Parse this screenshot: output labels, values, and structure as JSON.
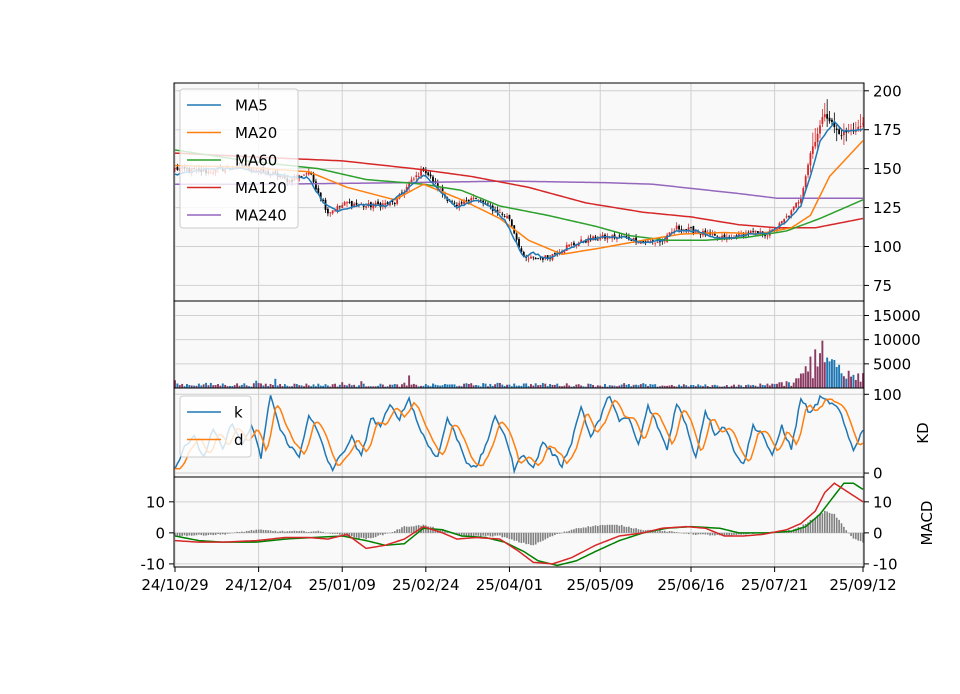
{
  "chart_data": {
    "type": "stock-candlestick",
    "x_tick_labels": [
      "24/10/29",
      "24/12/04",
      "25/01/09",
      "25/02/24",
      "25/04/01",
      "25/05/09",
      "25/06/16",
      "25/07/21",
      "25/09/12"
    ],
    "price_panel": {
      "ylim": [
        65,
        205
      ],
      "y_ticks": [
        75,
        100,
        125,
        150,
        175,
        200
      ],
      "legend": [
        "MA5",
        "MA20",
        "MA60",
        "MA120",
        "MA240"
      ],
      "legend_position": "upper-left",
      "series_colors": {
        "MA5": "#1f77b4",
        "MA20": "#ff7f0e",
        "MA60": "#2ca02c",
        "MA120": "#d62728",
        "MA240": "#9467bd"
      },
      "candle_up_color": "#d62728",
      "candle_down_color": "#000000",
      "close_anchors": [
        [
          0,
          150
        ],
        [
          14,
          148
        ],
        [
          28,
          152
        ],
        [
          42,
          146
        ],
        [
          48,
          142
        ],
        [
          56,
          148
        ],
        [
          64,
          122
        ],
        [
          72,
          128
        ],
        [
          80,
          126
        ],
        [
          92,
          128
        ],
        [
          98,
          140
        ],
        [
          104,
          150
        ],
        [
          112,
          134
        ],
        [
          118,
          125
        ],
        [
          124,
          132
        ],
        [
          132,
          125
        ],
        [
          140,
          118
        ],
        [
          146,
          92
        ],
        [
          156,
          93
        ],
        [
          164,
          100
        ],
        [
          172,
          104
        ],
        [
          180,
          106
        ],
        [
          188,
          106
        ],
        [
          196,
          103
        ],
        [
          204,
          103
        ],
        [
          210,
          112
        ],
        [
          218,
          110
        ],
        [
          226,
          106
        ],
        [
          232,
          105
        ],
        [
          240,
          109
        ],
        [
          248,
          108
        ],
        [
          252,
          112
        ],
        [
          258,
          122
        ],
        [
          262,
          132
        ],
        [
          266,
          160
        ],
        [
          272,
          186
        ],
        [
          278,
          172
        ],
        [
          284,
          175
        ],
        [
          288,
          178
        ]
      ],
      "ma5_anchors": [
        [
          0,
          146
        ],
        [
          14,
          150
        ],
        [
          28,
          150
        ],
        [
          42,
          146
        ],
        [
          56,
          144
        ],
        [
          62,
          128
        ],
        [
          68,
          123
        ],
        [
          78,
          127
        ],
        [
          88,
          126
        ],
        [
          96,
          135
        ],
        [
          104,
          146
        ],
        [
          112,
          134
        ],
        [
          118,
          125
        ],
        [
          126,
          130
        ],
        [
          132,
          126
        ],
        [
          138,
          117
        ],
        [
          146,
          93
        ],
        [
          150,
          96
        ],
        [
          156,
          92
        ],
        [
          164,
          98
        ],
        [
          172,
          104
        ],
        [
          180,
          106
        ],
        [
          188,
          106
        ],
        [
          196,
          102
        ],
        [
          204,
          104
        ],
        [
          210,
          110
        ],
        [
          218,
          110
        ],
        [
          226,
          106
        ],
        [
          232,
          105
        ],
        [
          240,
          108
        ],
        [
          248,
          108
        ],
        [
          256,
          116
        ],
        [
          262,
          126
        ],
        [
          266,
          145
        ],
        [
          270,
          168
        ],
        [
          276,
          180
        ],
        [
          280,
          174
        ],
        [
          288,
          175
        ]
      ],
      "ma20_anchors": [
        [
          0,
          152
        ],
        [
          28,
          151
        ],
        [
          56,
          148
        ],
        [
          72,
          138
        ],
        [
          92,
          130
        ],
        [
          104,
          140
        ],
        [
          120,
          130
        ],
        [
          136,
          118
        ],
        [
          148,
          104
        ],
        [
          162,
          95
        ],
        [
          178,
          99
        ],
        [
          196,
          104
        ],
        [
          212,
          108
        ],
        [
          230,
          109
        ],
        [
          244,
          108
        ],
        [
          258,
          112
        ],
        [
          266,
          120
        ],
        [
          274,
          145
        ],
        [
          288,
          168
        ]
      ],
      "ma60_anchors": [
        [
          0,
          162
        ],
        [
          30,
          155
        ],
        [
          60,
          150
        ],
        [
          80,
          143
        ],
        [
          104,
          140
        ],
        [
          120,
          136
        ],
        [
          136,
          126
        ],
        [
          156,
          120
        ],
        [
          176,
          113
        ],
        [
          190,
          107
        ],
        [
          206,
          104
        ],
        [
          222,
          104
        ],
        [
          240,
          106
        ],
        [
          256,
          110
        ],
        [
          270,
          118
        ],
        [
          288,
          130
        ]
      ],
      "ma120_anchors": [
        [
          0,
          160
        ],
        [
          40,
          157
        ],
        [
          70,
          155
        ],
        [
          100,
          150
        ],
        [
          124,
          145
        ],
        [
          148,
          138
        ],
        [
          172,
          128
        ],
        [
          196,
          122
        ],
        [
          216,
          119
        ],
        [
          236,
          114
        ],
        [
          252,
          112
        ],
        [
          268,
          112
        ],
        [
          288,
          118
        ]
      ],
      "ma240_anchors": [
        [
          0,
          140
        ],
        [
          40,
          140
        ],
        [
          96,
          141
        ],
        [
          140,
          142
        ],
        [
          180,
          141
        ],
        [
          200,
          140
        ],
        [
          236,
          134
        ],
        [
          252,
          131
        ],
        [
          268,
          131
        ],
        [
          288,
          131
        ]
      ]
    },
    "volume_panel": {
      "ylim": [
        0,
        18000
      ],
      "y_ticks": [
        5000,
        10000,
        15000
      ],
      "bar_up_color": "#8b3a62",
      "bar_down_color": "#1f77b4",
      "base_anchors": [
        [
          0,
          900
        ],
        [
          100,
          700
        ],
        [
          140,
          900
        ],
        [
          200,
          650
        ],
        [
          240,
          600
        ],
        [
          258,
          1200
        ],
        [
          262,
          3000
        ],
        [
          270,
          6000
        ],
        [
          278,
          5000
        ],
        [
          288,
          3500
        ]
      ],
      "spikes": [
        [
          0,
          1600
        ],
        [
          34,
          1500
        ],
        [
          42,
          1900
        ],
        [
          46,
          800
        ],
        [
          70,
          1200
        ],
        [
          78,
          1400
        ],
        [
          96,
          1100
        ],
        [
          98,
          2600
        ],
        [
          140,
          700
        ],
        [
          150,
          500
        ],
        [
          188,
          1000
        ],
        [
          196,
          1000
        ],
        [
          248,
          900
        ],
        [
          260,
          2000
        ],
        [
          264,
          4500
        ],
        [
          266,
          6500
        ],
        [
          268,
          8000
        ],
        [
          270,
          7200
        ],
        [
          271,
          9800
        ],
        [
          273,
          6300
        ],
        [
          276,
          5800
        ],
        [
          278,
          4800
        ]
      ]
    },
    "kd_panel": {
      "ylim": [
        -5,
        108
      ],
      "y_ticks": [
        0,
        100
      ],
      "ylabel": "KD",
      "legend": [
        "k",
        "d"
      ],
      "legend_position": "upper-left",
      "series_colors": {
        "k": "#1f77b4",
        "d": "#ff7f0e"
      },
      "k_anchors": [
        [
          0,
          5
        ],
        [
          4,
          35
        ],
        [
          8,
          45
        ],
        [
          12,
          20
        ],
        [
          16,
          55
        ],
        [
          20,
          30
        ],
        [
          24,
          65
        ],
        [
          28,
          35
        ],
        [
          32,
          60
        ],
        [
          36,
          20
        ],
        [
          40,
          100
        ],
        [
          44,
          55
        ],
        [
          48,
          35
        ],
        [
          52,
          20
        ],
        [
          56,
          75
        ],
        [
          60,
          50
        ],
        [
          64,
          15
        ],
        [
          66,
          5
        ],
        [
          70,
          25
        ],
        [
          74,
          45
        ],
        [
          78,
          20
        ],
        [
          82,
          70
        ],
        [
          86,
          60
        ],
        [
          90,
          85
        ],
        [
          94,
          70
        ],
        [
          98,
          95
        ],
        [
          102,
          60
        ],
        [
          106,
          35
        ],
        [
          110,
          20
        ],
        [
          114,
          70
        ],
        [
          118,
          45
        ],
        [
          122,
          15
        ],
        [
          126,
          5
        ],
        [
          130,
          35
        ],
        [
          134,
          70
        ],
        [
          138,
          50
        ],
        [
          142,
          5
        ],
        [
          146,
          25
        ],
        [
          150,
          5
        ],
        [
          154,
          40
        ],
        [
          158,
          25
        ],
        [
          162,
          10
        ],
        [
          166,
          40
        ],
        [
          170,
          85
        ],
        [
          174,
          45
        ],
        [
          178,
          70
        ],
        [
          182,
          100
        ],
        [
          186,
          65
        ],
        [
          190,
          70
        ],
        [
          194,
          35
        ],
        [
          198,
          85
        ],
        [
          202,
          60
        ],
        [
          206,
          30
        ],
        [
          210,
          90
        ],
        [
          214,
          60
        ],
        [
          218,
          20
        ],
        [
          222,
          80
        ],
        [
          226,
          50
        ],
        [
          230,
          60
        ],
        [
          234,
          30
        ],
        [
          238,
          10
        ],
        [
          242,
          60
        ],
        [
          246,
          50
        ],
        [
          250,
          20
        ],
        [
          254,
          60
        ],
        [
          258,
          30
        ],
        [
          262,
          95
        ],
        [
          266,
          75
        ],
        [
          270,
          95
        ],
        [
          274,
          90
        ],
        [
          278,
          80
        ],
        [
          282,
          45
        ],
        [
          284,
          30
        ],
        [
          288,
          55
        ]
      ],
      "d_lag": 2,
      "d_alpha": 0.5
    },
    "macd_panel": {
      "ylim": [
        -11,
        18
      ],
      "y_ticks": [
        -10,
        0,
        10
      ],
      "ylabel": "MACD",
      "dif_color": "#d62728",
      "macd_color": "#008000",
      "hist_color": "#808080",
      "dif_anchors": [
        [
          0,
          -2.5
        ],
        [
          10,
          -3
        ],
        [
          20,
          -3
        ],
        [
          34,
          -2.5
        ],
        [
          46,
          -1.5
        ],
        [
          56,
          -1.5
        ],
        [
          64,
          -2
        ],
        [
          72,
          -0.5
        ],
        [
          80,
          -5
        ],
        [
          88,
          -4
        ],
        [
          96,
          -2
        ],
        [
          104,
          2
        ],
        [
          112,
          0
        ],
        [
          118,
          -2
        ],
        [
          126,
          -1.5
        ],
        [
          136,
          -2
        ],
        [
          144,
          -6
        ],
        [
          150,
          -9.5
        ],
        [
          158,
          -10
        ],
        [
          166,
          -8
        ],
        [
          176,
          -4
        ],
        [
          186,
          -1
        ],
        [
          196,
          0
        ],
        [
          204,
          1.5
        ],
        [
          214,
          2
        ],
        [
          222,
          1.5
        ],
        [
          230,
          -1
        ],
        [
          238,
          -1
        ],
        [
          246,
          -0.5
        ],
        [
          256,
          1
        ],
        [
          262,
          3
        ],
        [
          268,
          7
        ],
        [
          272,
          13
        ],
        [
          276,
          16
        ],
        [
          280,
          14
        ],
        [
          284,
          12
        ],
        [
          288,
          10
        ]
      ],
      "macd_anchors": [
        [
          0,
          -1
        ],
        [
          10,
          -2.5
        ],
        [
          20,
          -3
        ],
        [
          34,
          -3
        ],
        [
          46,
          -2
        ],
        [
          58,
          -1.5
        ],
        [
          70,
          -1
        ],
        [
          80,
          -2.5
        ],
        [
          88,
          -4
        ],
        [
          96,
          -3.5
        ],
        [
          104,
          1.5
        ],
        [
          112,
          1
        ],
        [
          120,
          -1
        ],
        [
          130,
          -1.5
        ],
        [
          138,
          -3
        ],
        [
          146,
          -6
        ],
        [
          152,
          -9
        ],
        [
          160,
          -10.5
        ],
        [
          168,
          -9
        ],
        [
          176,
          -6
        ],
        [
          186,
          -2.5
        ],
        [
          196,
          0
        ],
        [
          206,
          1.5
        ],
        [
          216,
          2
        ],
        [
          228,
          1.5
        ],
        [
          236,
          0
        ],
        [
          248,
          0
        ],
        [
          258,
          0.5
        ],
        [
          264,
          2
        ],
        [
          270,
          6
        ],
        [
          276,
          12
        ],
        [
          280,
          16
        ],
        [
          284,
          16
        ],
        [
          288,
          14
        ]
      ],
      "hist_anchors": [
        [
          0,
          -1
        ],
        [
          20,
          -0.5
        ],
        [
          34,
          1
        ],
        [
          44,
          0.5
        ],
        [
          60,
          0.5
        ],
        [
          72,
          -1
        ],
        [
          80,
          -2
        ],
        [
          90,
          0
        ],
        [
          96,
          2
        ],
        [
          104,
          2.5
        ],
        [
          112,
          1
        ],
        [
          120,
          -1
        ],
        [
          136,
          -1
        ],
        [
          144,
          -3
        ],
        [
          150,
          -4
        ],
        [
          158,
          -1
        ],
        [
          168,
          1.5
        ],
        [
          178,
          2.5
        ],
        [
          186,
          2.5
        ],
        [
          196,
          1
        ],
        [
          206,
          0.5
        ],
        [
          218,
          -0.5
        ],
        [
          232,
          -1
        ],
        [
          244,
          0
        ],
        [
          256,
          0.5
        ],
        [
          262,
          2
        ],
        [
          268,
          5
        ],
        [
          272,
          7
        ],
        [
          276,
          6
        ],
        [
          280,
          2
        ],
        [
          284,
          -2
        ],
        [
          288,
          -3
        ]
      ]
    }
  }
}
